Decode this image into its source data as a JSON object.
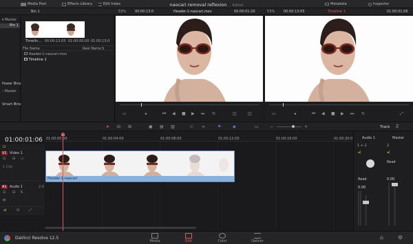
{
  "topbar": {
    "media_pool": "Media Pool",
    "effects_library": "Effects Library",
    "edit_index": "Edit Index",
    "metadata": "Metadata",
    "inspector": "Inspector"
  },
  "project": {
    "title": "naocari removal reflexion",
    "status": "Edited"
  },
  "source_viewer": {
    "zoom": "53%",
    "timecode_left": "00:00:13:0",
    "clip_name": "Header-1-naocari.mov",
    "timecode_right": "00:00:01:20"
  },
  "program_viewer": {
    "zoom": "53%",
    "timecode_left": "00:00:13:05",
    "timeline_name": "Timeline 1",
    "timecode_right": "01:00:01:06"
  },
  "sidebar": {
    "master": "Master",
    "bin1": "Bin 1",
    "power_bins": "Power Bins",
    "power_master": "Master",
    "smart_bins": "Smart Bins"
  },
  "mediapool": {
    "bin_title": "Bin 1",
    "thumb1_label": "Timelin...",
    "thumb1_tc": "01:00:00:00",
    "thumb2_tc": "00:00:13:05",
    "thumb3_tc": "01:00:13:0",
    "col_filename": "File Name",
    "col_reelname": "Reel Name",
    "col_s": "S",
    "rows": [
      "Header-1-naocari.mov",
      "Timeline 1"
    ]
  },
  "timeline": {
    "timecode": "01:00:01:06",
    "ruler": [
      "01:00:00:00",
      "01:00:04:00",
      "01:00:08:00",
      "01:00:12:00",
      "01:00:16:00",
      "01:00:20:0"
    ],
    "track_label": "Track",
    "video_track": {
      "id": "V1",
      "name": "Video 1",
      "clips": "1 Clip"
    },
    "audio_track": {
      "id": "A1",
      "name": "Audio 1",
      "channels": "2.0"
    },
    "clip_name": "Header-1-naocari"
  },
  "mixer": {
    "audio1": "Audio 1",
    "master": "Master",
    "route1": "1 + 2",
    "route2": "2",
    "read1": "Read",
    "read2": "Read",
    "gain1": "0.00",
    "gain2": "0.00"
  },
  "bottombar": {
    "app_name": "DaVinci Resolve 12.5",
    "pages": [
      "Media",
      "Edit",
      "Color",
      "Deliver"
    ],
    "active_page": "Edit"
  },
  "colors": {
    "accent_red": "#e05a5a",
    "clip_blue": "#8ab0dc",
    "active_page": "#d9434a"
  },
  "icons": [
    "media-pool-icon",
    "effects-library-icon",
    "edit-index-icon",
    "metadata-icon",
    "inspector-icon",
    "play-icon",
    "stop-icon",
    "prev-icon",
    "next-icon",
    "loop-icon",
    "pointer-icon",
    "trim-icon",
    "link-icon",
    "flag-icon",
    "marker-icon",
    "speaker-icon",
    "home-icon",
    "gear-icon"
  ]
}
